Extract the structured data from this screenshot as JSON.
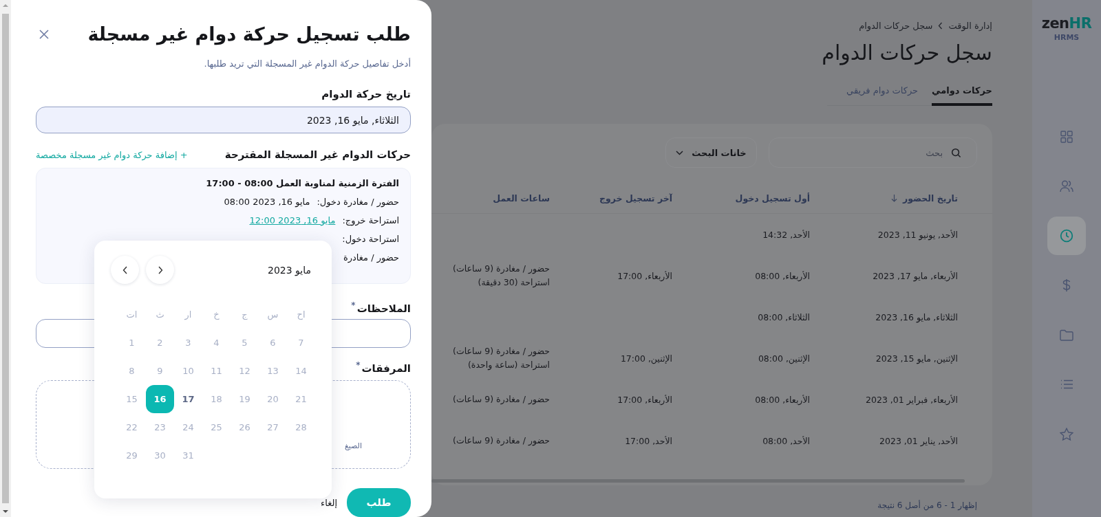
{
  "modal": {
    "title": "طلب تسجيل حركة دوام غير مسجلة",
    "subtitle": "أدخل تفاصيل حركة الدوام غير المسجلة التي تريد طلبها.",
    "date_field": {
      "label": "تاريخ حركة الدوام",
      "value": "الثلاثاء, مايو 16, 2023"
    },
    "suggested": {
      "label": "حركات الدوام غير المسجلة المقترحة",
      "add_link": "+ إضافة حركة دوام غير مسجلة مخصصة",
      "shift_title": "الفترة الزمنية لمناوبة العمل 08:00 - 17:00",
      "entries": [
        {
          "kind": "text",
          "label": "حضور / مغادرة دخول:",
          "value": "مايو 16, 2023 08:00"
        },
        {
          "kind": "link",
          "label": "استراحة خروج:",
          "value": "مايو 16, 2023 12:00"
        },
        {
          "label": "استراحة دخول:"
        },
        {
          "label": "حضور / مغادرة"
        }
      ]
    },
    "notes": {
      "label": "الملاحظات",
      "required_mark": "*"
    },
    "attachments": {
      "label": "المرفقات",
      "required_mark": "*",
      "hint": "الصيغ"
    },
    "buttons": {
      "submit": "طلب",
      "cancel": "إلغاء"
    },
    "calendar": {
      "month": "مايو 2023",
      "weekdays": [
        "اح",
        "س",
        "ج",
        "خ",
        "ار",
        "ث",
        "ات"
      ],
      "days": [
        {
          "label": "7",
          "selected": false,
          "today": false
        },
        {
          "label": "6",
          "selected": false,
          "today": false
        },
        {
          "label": "5",
          "selected": false,
          "today": false
        },
        {
          "label": "4",
          "selected": false,
          "today": false
        },
        {
          "label": "3",
          "selected": false,
          "today": false
        },
        {
          "label": "2",
          "selected": false,
          "today": false
        },
        {
          "label": "1",
          "selected": false,
          "today": false
        },
        {
          "label": "14",
          "selected": false,
          "today": false
        },
        {
          "label": "13",
          "selected": false,
          "today": false
        },
        {
          "label": "12",
          "selected": false,
          "today": false
        },
        {
          "label": "11",
          "selected": false,
          "today": false
        },
        {
          "label": "10",
          "selected": false,
          "today": false
        },
        {
          "label": "9",
          "selected": false,
          "today": false
        },
        {
          "label": "8",
          "selected": false,
          "today": false
        },
        {
          "label": "21",
          "selected": false,
          "today": false
        },
        {
          "label": "20",
          "selected": false,
          "today": false
        },
        {
          "label": "19",
          "selected": false,
          "today": false
        },
        {
          "label": "18",
          "selected": false,
          "today": false
        },
        {
          "label": "17",
          "selected": false,
          "today": true
        },
        {
          "label": "16",
          "selected": true,
          "today": false
        },
        {
          "label": "15",
          "selected": false,
          "today": false
        },
        {
          "label": "28",
          "selected": false,
          "today": false
        },
        {
          "label": "27",
          "selected": false,
          "today": false
        },
        {
          "label": "26",
          "selected": false,
          "today": false
        },
        {
          "label": "25",
          "selected": false,
          "today": false
        },
        {
          "label": "24",
          "selected": false,
          "today": false
        },
        {
          "label": "23",
          "selected": false,
          "today": false
        },
        {
          "label": "22",
          "selected": false,
          "today": false
        },
        {
          "label": "31",
          "selected": false,
          "today": false
        },
        {
          "label": "30",
          "selected": false,
          "today": false
        },
        {
          "label": "29",
          "selected": false,
          "today": false
        }
      ]
    }
  },
  "page": {
    "breadcrumb": [
      "إدارة الوقت",
      "سجل حركات الدوام"
    ],
    "title": "سجل حركات الدوام",
    "tabs": [
      {
        "label": "حركات دوامي",
        "selected": true
      },
      {
        "label": "حركات دوام فريقي",
        "selected": false
      }
    ],
    "search": {
      "placeholder": "بحث"
    },
    "filter": "خانات البحث",
    "table": {
      "columns": [
        {
          "label": "تاريخ الحضور",
          "sorted": true
        },
        {
          "label": "أول تسجيل دخول",
          "sorted": false
        },
        {
          "label": "آخر تسجيل خروج",
          "sorted": false
        },
        {
          "label": "ساعات العمل",
          "sorted": false
        }
      ],
      "rows": [
        {
          "date": "الأحد, يونيو 11, 2023",
          "first_in": "الأحد, 14:32"
        },
        {
          "date": "الأربعاء, مايو 17, 2023",
          "first_in": "الأربعاء, 08:00",
          "last_out": "الأربعاء, 17:00",
          "hours": "حضور / مغادرة (9 ساعات)\nاستراحة (30 دقيقة)"
        },
        {
          "date": "الثلاثاء, مايو 16, 2023",
          "first_in": "الثلاثاء, 08:00"
        },
        {
          "date": "الإثنين, مايو 15, 2023",
          "first_in": "الإثنين, 08:00",
          "last_out": "الإثنين, 17:00",
          "hours": "حضور / مغادرة (9 ساعات)\nاستراحة (ساعة واحدة)"
        },
        {
          "date": "الأربعاء, فبراير 01, 2023",
          "first_in": "الأربعاء, 08:00",
          "last_out": "الأربعاء, 17:00",
          "hours": "حضور / مغادرة (9 ساعات)"
        },
        {
          "date": "الأحد, يناير 01, 2023",
          "first_in": "الأحد, 08:00",
          "last_out": "الأحد, 17:00",
          "hours": "حضور / مغادرة (9 ساعات)"
        }
      ]
    },
    "pagination": "إظهار 1 - 6 من أصل 6 نتيجة"
  },
  "sidebar": {
    "logo": {
      "name": "zen",
      "accent": "HR",
      "subtitle": "HRMS"
    },
    "items": [
      {
        "kind": "grid",
        "selected": false
      },
      {
        "kind": "people",
        "selected": false
      },
      {
        "kind": "clock",
        "selected": true
      },
      {
        "kind": "dollar",
        "selected": false
      },
      {
        "kind": "folder",
        "selected": false
      },
      {
        "kind": "list",
        "selected": false
      },
      {
        "kind": "star",
        "selected": false
      }
    ]
  }
}
